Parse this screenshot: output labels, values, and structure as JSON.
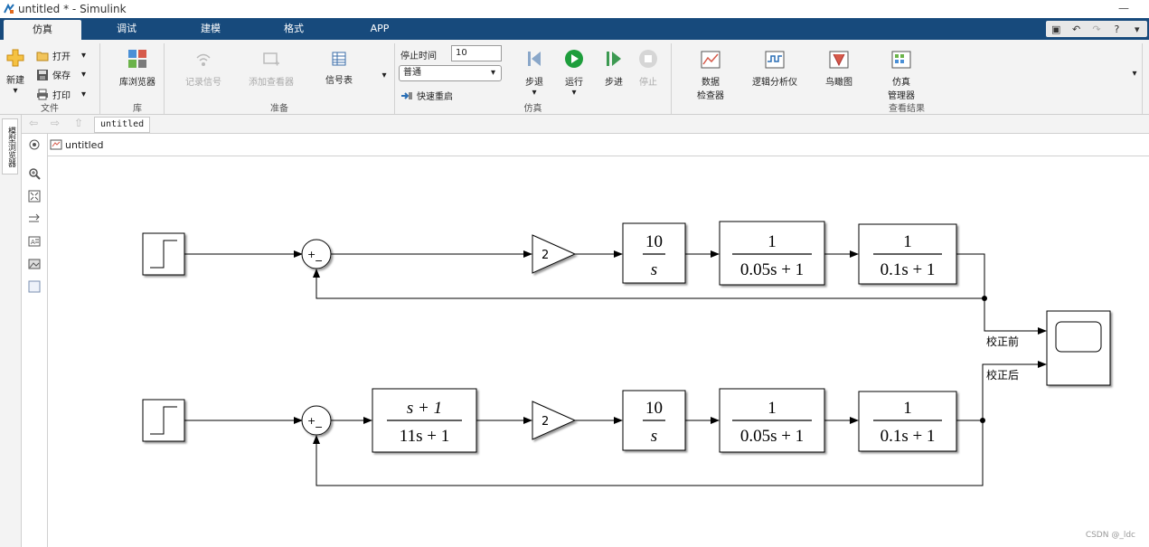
{
  "window": {
    "title": "untitled * - Simulink"
  },
  "tabs": [
    {
      "label": "仿真",
      "active": true
    },
    {
      "label": "调试"
    },
    {
      "label": "建模"
    },
    {
      "label": "格式"
    },
    {
      "label": "APP"
    }
  ],
  "ribbon": {
    "file": {
      "section": "文件",
      "new": "新建",
      "open": "打开",
      "save": "保存",
      "print": "打印"
    },
    "library": {
      "section": "库",
      "browser": "库浏览器"
    },
    "prepare": {
      "section": "准备",
      "log_signals": "记录信号",
      "add_viewer": "添加查看器",
      "signal_table": "信号表"
    },
    "simulate": {
      "section": "仿真",
      "stop_time_label": "停止时间",
      "stop_time": "10",
      "mode": "普通",
      "fast_restart": "快速重启",
      "step_back": "步退",
      "run": "运行",
      "step_forward": "步进",
      "stop": "停止"
    },
    "review": {
      "section": "查看结果",
      "data_inspector_1": "数据",
      "data_inspector_2": "检查器",
      "logic_analyzer": "逻辑分析仪",
      "birds_eye": "鸟瞰图",
      "sim_manager_1": "仿真",
      "sim_manager_2": "管理器"
    }
  },
  "address": {
    "tab": "untitled"
  },
  "side_panel": {
    "label": "模型浏览器"
  },
  "breadcrumb": {
    "model": "untitled"
  },
  "diagram": {
    "gain": "2",
    "top": {
      "integrator": {
        "num": "10",
        "den": "s"
      },
      "tf1": {
        "num": "1",
        "den": "0.05s + 1"
      },
      "tf2": {
        "num": "1",
        "den": "0.1s + 1"
      },
      "signal_label": "校正前"
    },
    "bottom": {
      "compensator": {
        "num": "s + 1",
        "den": "11s + 1"
      },
      "integrator": {
        "num": "10",
        "den": "s"
      },
      "tf1": {
        "num": "1",
        "den": "0.05s + 1"
      },
      "tf2": {
        "num": "1",
        "den": "0.1s + 1"
      },
      "signal_label": "校正后"
    },
    "sum_signs": {
      "plus": "+",
      "minus": "−"
    }
  },
  "watermark": "CSDN @_ldc",
  "colors": {
    "tabbar": "#174a7c",
    "ribbon": "#f3f3f3",
    "run_green": "#1e9e3c"
  }
}
